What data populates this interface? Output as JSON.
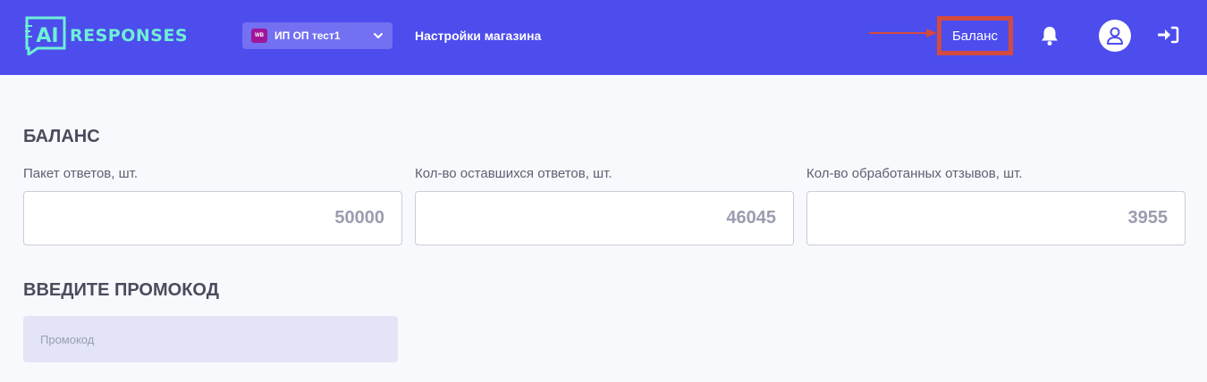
{
  "header": {
    "logo_text": "RESPONSES",
    "logo_mark": "AI",
    "store": {
      "badge": "WB",
      "name": "ИП ОП тест1"
    },
    "settings_link": "Настройки магазина",
    "balance_link": "Баланс",
    "icons": [
      "bell-icon",
      "user-icon",
      "logout-icon",
      "chevron-down-icon",
      "arrow-right-icon"
    ]
  },
  "balance": {
    "title": "БАЛАНС",
    "fields": [
      {
        "label": "Пакет ответов, шт.",
        "value": "50000"
      },
      {
        "label": "Кол-во оставшихся ответов, шт.",
        "value": "46045"
      },
      {
        "label": "Кол-во обработанных отзывов, шт.",
        "value": "3955"
      }
    ]
  },
  "promo": {
    "title": "ВВЕДИТЕ ПРОМОКОД",
    "placeholder": "Промокод"
  },
  "colors": {
    "header_bg": "#4d4ced",
    "logo_accent": "#6ef0d5",
    "highlight": "#d24b3e",
    "store_badge": "#a0169b"
  }
}
